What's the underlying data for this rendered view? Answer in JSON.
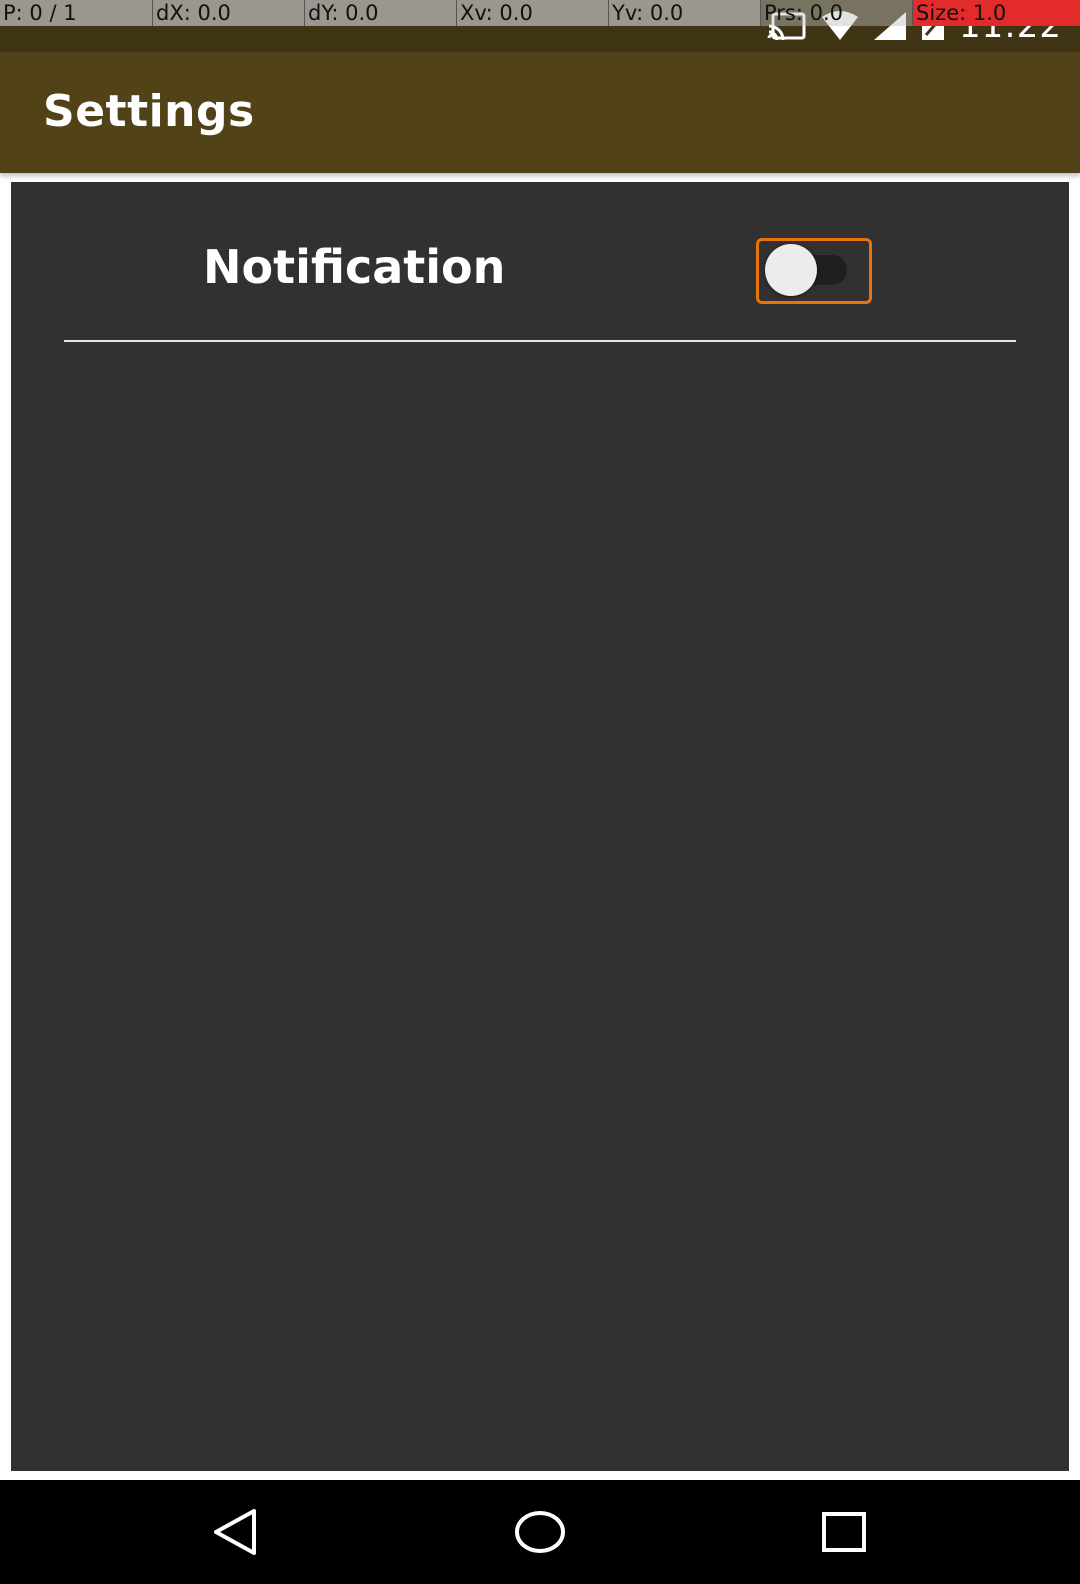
{
  "overlay": {
    "pointer": "P: 0 / 1",
    "dx": "dX: 0.0",
    "dy": "dY: 0.0",
    "xv": "Xv: 0.0",
    "yv": "Yv: 0.0",
    "prs": "Prs: 0.0",
    "size": "Size: 1.0"
  },
  "status_bar": {
    "time": "11:22",
    "icons": [
      "cast-icon",
      "wifi-icon",
      "signal-icon",
      "battery-icon"
    ]
  },
  "app_bar": {
    "title": "Settings",
    "color": "#524217"
  },
  "settings": {
    "items": [
      {
        "label": "Notification",
        "toggle_on": false
      }
    ]
  },
  "colors": {
    "status_bar": "#3f3414",
    "card_background": "#313131",
    "focus_outline": "#e9730f"
  },
  "nav_bar": {
    "buttons": [
      "back-icon",
      "home-icon",
      "recents-icon"
    ]
  }
}
